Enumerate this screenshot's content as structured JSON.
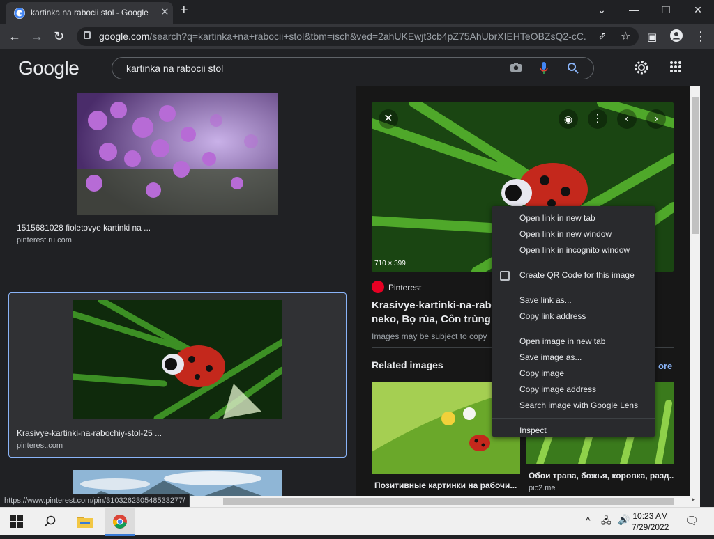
{
  "browser": {
    "tab_title": "kartinka na rabocii stol - Google",
    "url_domain": "google.com",
    "url_path": "/search?q=kartinka+na+rabocii+stol&tbm=isch&ved=2ahUKEwjt3cb4pZ75AhUbrXIEHTeOBZsQ2-cC..."
  },
  "google": {
    "logo": "Google",
    "query": "kartinka na rabocii stol"
  },
  "results": [
    {
      "caption": "1515681028 fioletovye kartinki na ...",
      "source": "pinterest.ru.com"
    },
    {
      "caption": "Krasivye-kartinki-na-rabochiy-stol-25 ...",
      "source": "pinterest.com"
    }
  ],
  "preview": {
    "dimensions": "710 × 399",
    "site": "Pinterest",
    "title_line1": "Krasivye-kartinki-na-rabo",
    "title_line2": "neko, Bọ rùa, Côn trùng",
    "notice": "Images may be subject to copy",
    "related_heading": "Related images",
    "more": "ore",
    "related": [
      {
        "caption": "Позитивные картинки на рабочи...",
        "source": ""
      },
      {
        "caption": "Обои трава, божья, коровка, разд...",
        "source": "pic2.me"
      }
    ]
  },
  "context_menu": {
    "group1": [
      "Open link in new tab",
      "Open link in new window",
      "Open link in incognito window"
    ],
    "group2": [
      "Create QR Code for this image"
    ],
    "group3": [
      "Save link as...",
      "Copy link address"
    ],
    "group4": [
      "Open image in new tab",
      "Save image as...",
      "Copy image",
      "Copy image address",
      "Search image with Google Lens"
    ],
    "group5": [
      "Inspect"
    ]
  },
  "status_url": "https://www.pinterest.com/pin/310326230548533277/",
  "taskbar": {
    "time": "10:23 AM",
    "date": "7/29/2022"
  }
}
